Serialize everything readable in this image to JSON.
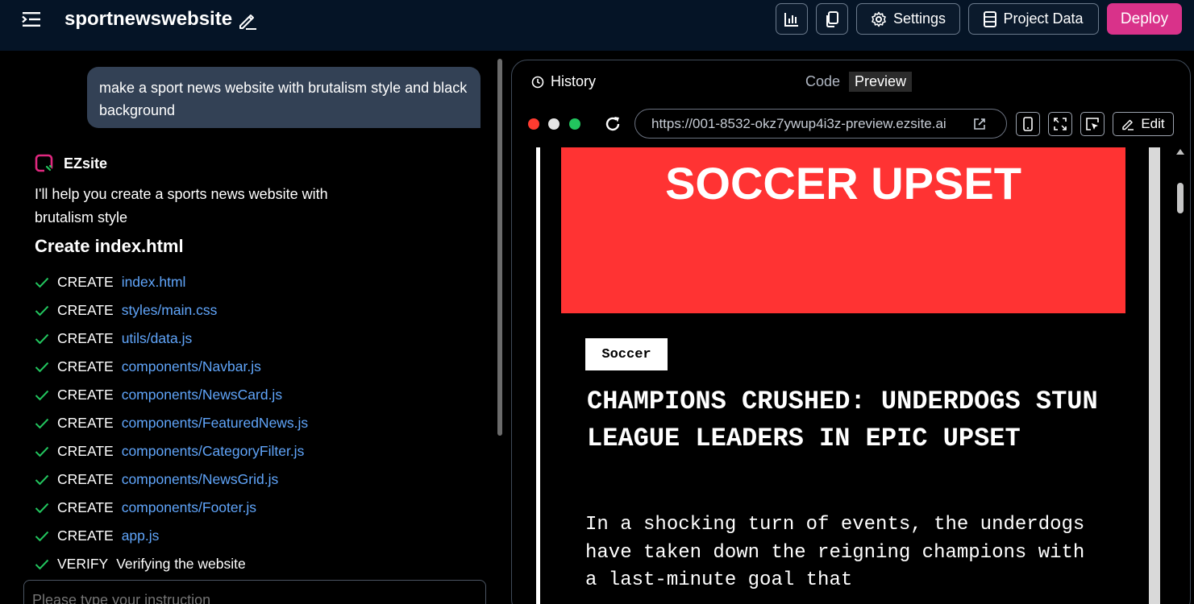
{
  "header": {
    "project_title": "sportnewswebsite",
    "settings_label": "Settings",
    "project_data_label": "Project Data",
    "deploy_label": "Deploy"
  },
  "chat": {
    "user_message": "make a sport news website with brutalism style and black background",
    "bot_name": "EZsite",
    "bot_message": "I'll help you create a sports news website with brutalism style",
    "step_heading": "Create index.html",
    "steps": [
      {
        "action": "CREATE",
        "target": "index.html"
      },
      {
        "action": "CREATE",
        "target": "styles/main.css"
      },
      {
        "action": "CREATE",
        "target": "utils/data.js"
      },
      {
        "action": "CREATE",
        "target": "components/Navbar.js"
      },
      {
        "action": "CREATE",
        "target": "components/NewsCard.js"
      },
      {
        "action": "CREATE",
        "target": "components/FeaturedNews.js"
      },
      {
        "action": "CREATE",
        "target": "components/CategoryFilter.js"
      },
      {
        "action": "CREATE",
        "target": "components/NewsGrid.js"
      },
      {
        "action": "CREATE",
        "target": "components/Footer.js"
      },
      {
        "action": "CREATE",
        "target": "app.js"
      },
      {
        "action": "VERIFY",
        "target": "Verifying the website"
      }
    ],
    "input_placeholder": "Please type your instruction"
  },
  "preview": {
    "history_label": "History",
    "tabs": [
      {
        "label": "Code",
        "active": false
      },
      {
        "label": "Preview",
        "active": true
      }
    ],
    "url": "https://001-8532-okz7ywup4i3z-preview.ezsite.ai",
    "edit_label": "Edit",
    "window_dot_colors": [
      "#ff3b30",
      "#e5e5e5",
      "#22c55e"
    ]
  },
  "site": {
    "hero_title": "SOCCER UPSET",
    "hero_color": "#ff3333",
    "category": "Soccer",
    "headline": "CHAMPIONS CRUSHED: UNDERDOGS STUN LEAGUE LEADERS IN EPIC UPSET",
    "excerpt": "In a shocking turn of events, the underdogs have taken down the reigning champions with a last-minute goal that"
  },
  "colors": {
    "topbar_bg": "#051426",
    "deploy_accent": "#d9328a",
    "link": "#60a5fa",
    "check": "#22c55e",
    "user_bubble": "#334155"
  }
}
